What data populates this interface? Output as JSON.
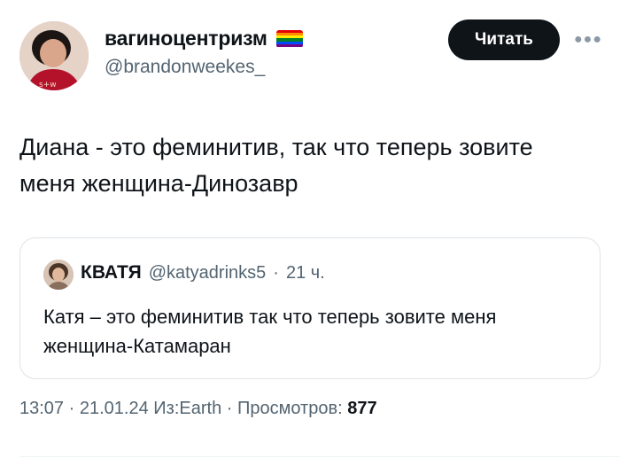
{
  "author": {
    "display_name": "вагиноцентризм",
    "handle": "@brandonweekes_",
    "flag_icon": "rainbow-flag-icon",
    "flag_colors": [
      "#e40303",
      "#ff8c00",
      "#ffed00",
      "#008026",
      "#004dff",
      "#750787"
    ]
  },
  "actions": {
    "follow_label": "Читать",
    "more_icon": "more-horizontal-icon"
  },
  "tweet": {
    "text": "Диана - это феминитив, так что теперь зовите меня женщина-Динозавр"
  },
  "quote": {
    "name": "КВАТЯ",
    "handle": "@katyadrinks5",
    "separator": "·",
    "time": "21 ч.",
    "text": "Катя – это феминитив так что теперь зовите меня женщина-Катамаран"
  },
  "meta": {
    "time": "13:07",
    "sep1": "·",
    "date": "21.01.24",
    "source": "Из:Earth",
    "sep2": "·",
    "views_label": "Просмотров:",
    "views_count": "877"
  },
  "colors": {
    "text_primary": "#0f1419",
    "text_secondary": "#536471",
    "border": "#dfe3e7"
  }
}
